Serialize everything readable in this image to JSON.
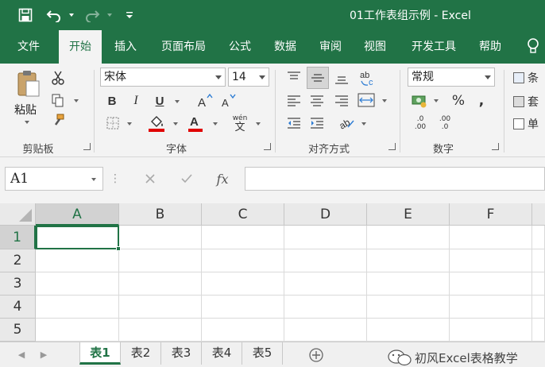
{
  "window": {
    "title": "01工作表组示例 - Excel"
  },
  "qat": {
    "save": "save-icon",
    "undo": "undo-icon",
    "redo": "redo-icon",
    "customize": "customize-icon"
  },
  "tabs": [
    "文件",
    "开始",
    "插入",
    "页面布局",
    "公式",
    "数据",
    "审阅",
    "视图",
    "开发工具",
    "帮助"
  ],
  "ribbon": {
    "clipboard": {
      "paste_label": "粘贴",
      "group_label": "剪贴板"
    },
    "font": {
      "font_name": "宋体",
      "font_size": "14",
      "group_label": "字体",
      "bold": "B",
      "italic": "I",
      "underline": "U",
      "phonetic": "wén",
      "phonetic_char": "文"
    },
    "alignment": {
      "group_label": "对齐方式"
    },
    "number": {
      "format": "常规",
      "percent": "%",
      "comma": ",",
      "group_label": "数字",
      "inc_decimal_top": ".0",
      "inc_decimal_bottom": ".00",
      "dec_decimal_top": ".00",
      "dec_decimal_bottom": ".0"
    },
    "styles": {
      "items": [
        "条",
        "套",
        "单"
      ]
    }
  },
  "formula_bar": {
    "name_box": "A1",
    "fx": "fx",
    "value": ""
  },
  "grid": {
    "columns": [
      "A",
      "B",
      "C",
      "D",
      "E",
      "F"
    ],
    "rows": [
      "1",
      "2",
      "3",
      "4",
      "5"
    ],
    "selected_cell": "A1"
  },
  "sheets": {
    "tabs": [
      "表1",
      "表2",
      "表3",
      "表4",
      "表5"
    ],
    "active": "表1"
  },
  "watermark": "初风Excel表格教学",
  "colors": {
    "accent": "#217346",
    "ribbon_bg": "#f3f3f3",
    "font_color": "#e00000"
  }
}
